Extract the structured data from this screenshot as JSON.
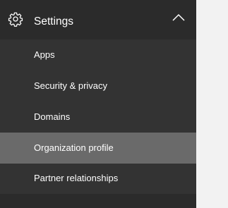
{
  "nav": {
    "section": {
      "title": "Settings",
      "icon": "gear-icon",
      "expand_icon": "chevron-up-icon",
      "expanded": true
    },
    "items": [
      {
        "label": "Apps",
        "active": false
      },
      {
        "label": "Security & privacy",
        "active": false
      },
      {
        "label": "Domains",
        "active": false
      },
      {
        "label": "Organization profile",
        "active": true
      },
      {
        "label": "Partner relationships",
        "active": false
      }
    ]
  },
  "colors": {
    "nav_background": "#2b2b2b",
    "submenu_background": "#333333",
    "active_item": "#6a6a6a",
    "text": "#ffffff",
    "page_background": "#f2f2f2"
  }
}
